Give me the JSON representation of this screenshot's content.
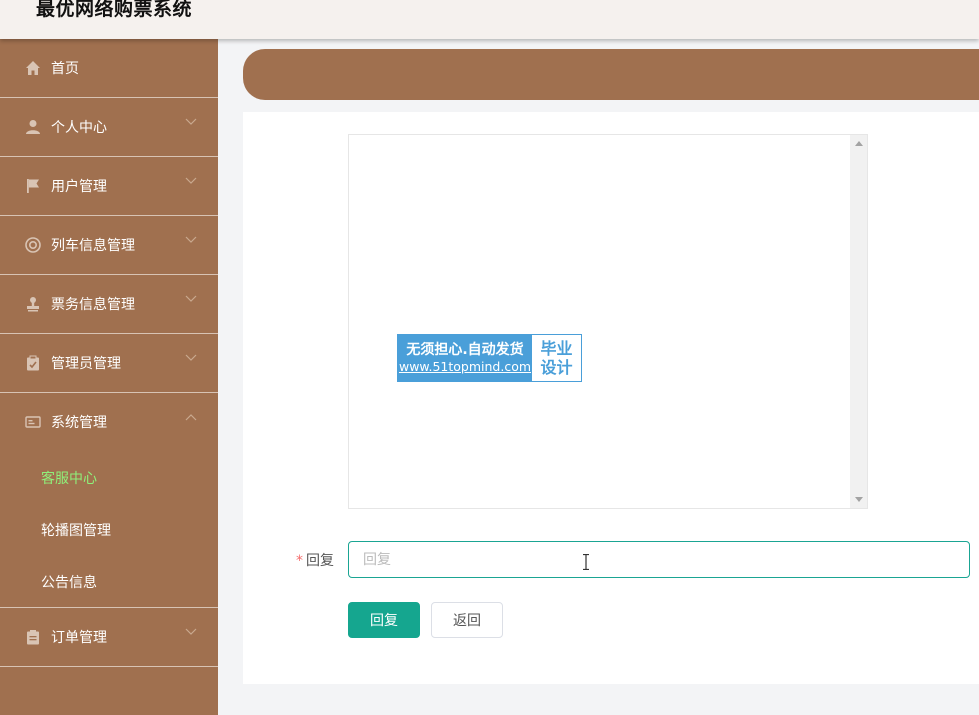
{
  "header": {
    "title": "最优网络购票系统"
  },
  "sidebar": {
    "items": [
      {
        "label": "首页",
        "icon": "home-icon",
        "expandable": false
      },
      {
        "label": "个人中心",
        "icon": "user-icon",
        "expandable": true
      },
      {
        "label": "用户管理",
        "icon": "flag-icon",
        "expandable": true
      },
      {
        "label": "列车信息管理",
        "icon": "lifebuoy-icon",
        "expandable": true
      },
      {
        "label": "票务信息管理",
        "icon": "stamp-icon",
        "expandable": true
      },
      {
        "label": "管理员管理",
        "icon": "clipboard-icon",
        "expandable": true
      },
      {
        "label": "系统管理",
        "icon": "id-card-icon",
        "expandable": true,
        "expanded": true,
        "children": [
          {
            "label": "客服中心",
            "active": true
          },
          {
            "label": "轮播图管理"
          },
          {
            "label": "公告信息"
          }
        ]
      },
      {
        "label": "订单管理",
        "icon": "list-icon",
        "expandable": true
      }
    ]
  },
  "chat": {
    "ad": {
      "line1": "无须担心.自动发货",
      "line2": "www.51topmind.com",
      "side1": "毕业",
      "side2": "设计"
    }
  },
  "form": {
    "reply_label": "回复",
    "required_mark": "*",
    "reply_placeholder": "回复",
    "reply_value": ""
  },
  "buttons": {
    "submit": "回复",
    "back": "返回"
  },
  "colors": {
    "accent": "#a0704f",
    "primary": "#15a68f",
    "active_menu": "#8ff07a",
    "ad_blue": "#4a9fd9"
  }
}
